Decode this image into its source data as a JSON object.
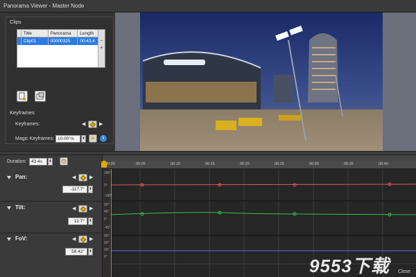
{
  "window": {
    "title": "Panorama Viewer - Master Node"
  },
  "clips": {
    "section_label": "Clips",
    "columns": [
      "Title",
      "Panorama",
      "Length"
    ],
    "rows": [
      {
        "title": "Clip01",
        "panorama": "00000325",
        "length": "00:43.4"
      }
    ]
  },
  "keyframes": {
    "section_label": "Keyframes",
    "keyframes_label": "Keyframes:",
    "magic_label": "Magic Keyframes:",
    "magic_value": "10.00°/s"
  },
  "timeline": {
    "duration_label": "Duration:",
    "duration_value": "43.4s",
    "ticks": [
      "00:00",
      "00:05",
      "00:10",
      "00:15",
      "00:20",
      "00:25",
      "00:30",
      "00:35",
      "00:40"
    ],
    "tracks": [
      {
        "name": "Pan:",
        "value": "-117.7°",
        "scale": [
          "180°",
          "0°",
          "-180°"
        ]
      },
      {
        "name": "Tilt:",
        "value": "12.7°",
        "scale": [
          "90°",
          "45°",
          "0°",
          "-45°"
        ]
      },
      {
        "name": "FoV:",
        "value": "58.42°",
        "scale": [
          "90°",
          "60°",
          "30°",
          "0°"
        ]
      }
    ],
    "close_label": "Close"
  },
  "colors": {
    "pan": "#e05a5a",
    "tilt": "#38c24a",
    "fov": "#6a6ad8",
    "selection": "#2b7be0",
    "keyframe": "#e2a800"
  },
  "watermark": "9553下载"
}
